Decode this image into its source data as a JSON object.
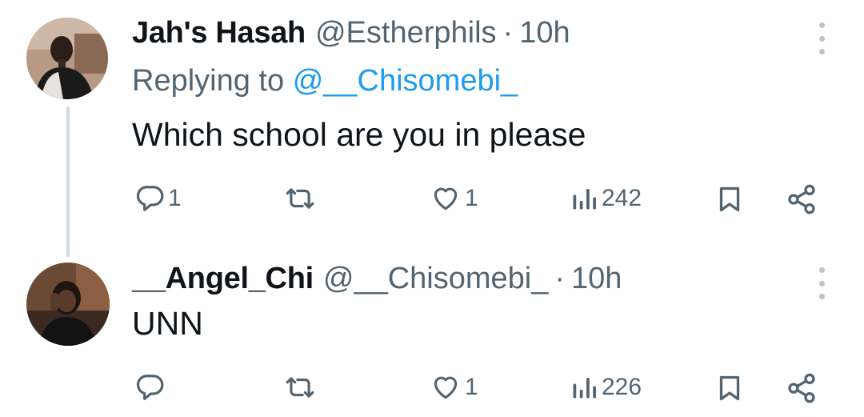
{
  "tweets": [
    {
      "display_name": "Jah's Hasah",
      "handle": "@Estherphils",
      "separator": "·",
      "time": "10h",
      "reply_prefix": "Replying to",
      "reply_mention": "@__Chisomebi_",
      "text": "Which school are you in please",
      "stats": {
        "replies": "1",
        "likes": "1",
        "views": "242"
      }
    },
    {
      "display_name": "__Angel_Chi",
      "handle": "@__Chisomebi_",
      "separator": "·",
      "time": "10h",
      "text": "UNN",
      "stats": {
        "likes": "1",
        "views": "226"
      }
    }
  ],
  "icons": {
    "reply": "reply-bubble-icon",
    "retweet": "retweet-icon",
    "like": "heart-icon",
    "views": "bar-chart-icon",
    "bookmark": "bookmark-icon",
    "share": "share-icon",
    "more": "more-vertical-icon"
  },
  "colors": {
    "text": "#0f1419",
    "secondary": "#536471",
    "link": "#1d9bf0",
    "thread_line": "#cfd9de"
  }
}
